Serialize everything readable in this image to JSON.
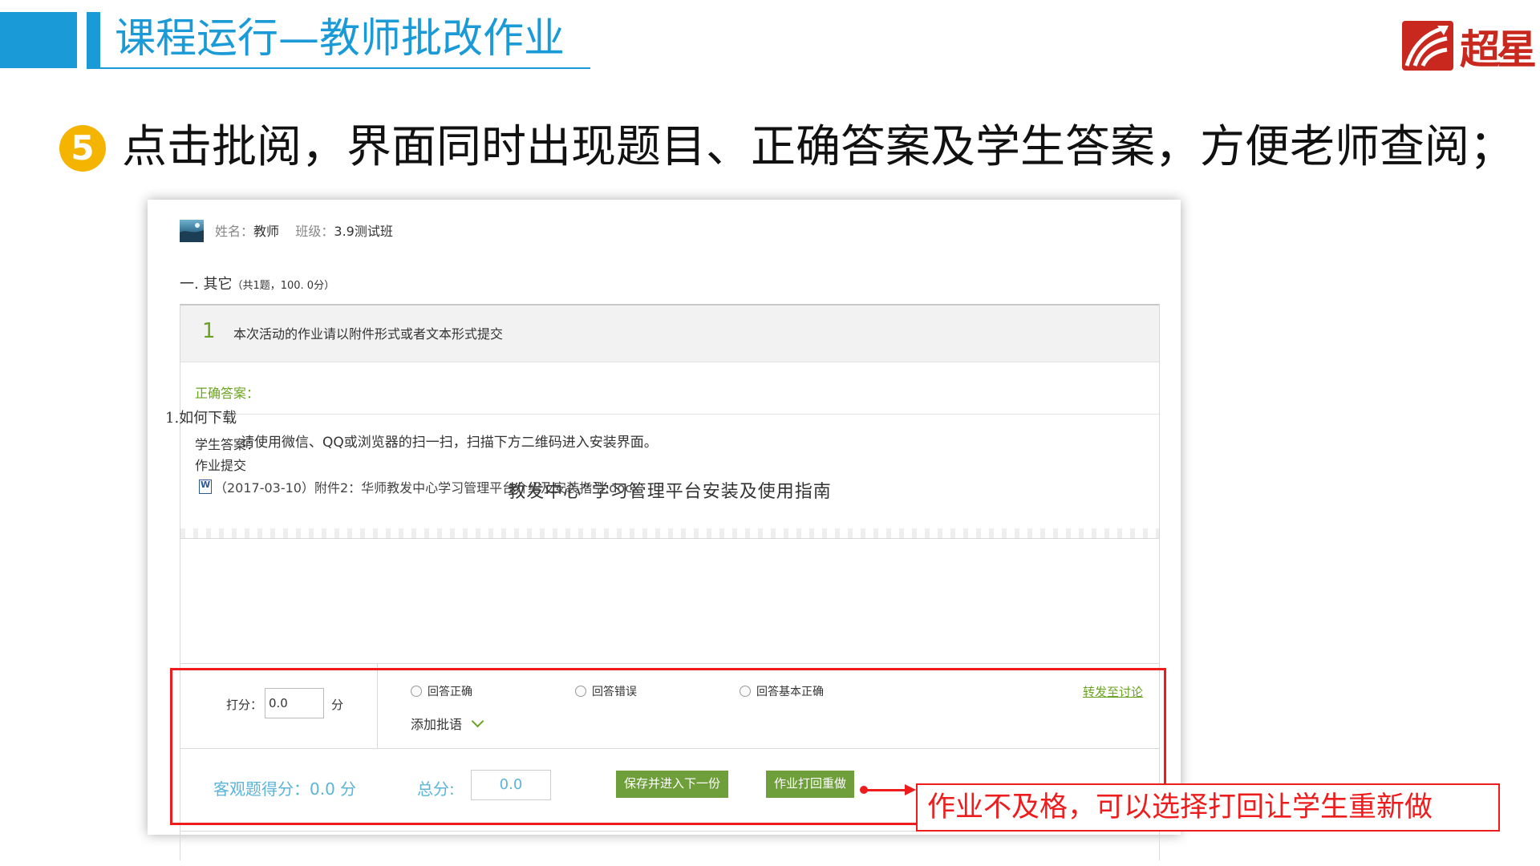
{
  "slide": {
    "title": "课程运行—教师批改作业",
    "logo_text": "超星",
    "bullet_number": "5",
    "bullet_text": "点击批阅，界面同时出现题目、正确答案及学生答案，方便老师查阅；",
    "callout_text": "作业不及格，可以选择打回让学生重新做"
  },
  "student": {
    "name_label": "姓名：",
    "name": "教师",
    "class_label": "班级：",
    "class": "3.9测试班"
  },
  "section": {
    "title": "一. 其它",
    "meta": "（共1题，100. 0分）"
  },
  "question": {
    "number": "1",
    "text": "本次活动的作业请以附件形式或者文本形式提交",
    "correct_answer_label": "正确答案：",
    "student_answer_label": "学生答案：",
    "student_answer_sub": "作业提交",
    "doc_title": "教发中心”学习管理平台安装及使用指南",
    "howto_title": "1.如何下载",
    "howto_body": "请使用微信、QQ或浏览器的扫一扫，扫描下方二维码进入安装界面。",
    "attachment": "（2017-03-10）附件2：华师教发中心学习管理平台介绍及安装指引.docx"
  },
  "grading": {
    "score_label": "打分：",
    "score_value": "0.0",
    "score_unit": "分",
    "radio_correct": "回答正确",
    "radio_wrong": "回答错误",
    "radio_partial": "回答基本正确",
    "forward_link": "转发至讨论",
    "add_comment": "添加批语",
    "objective_score": "客观题得分：0.0 分",
    "total_label": "总分:",
    "total_value": "0.0",
    "save_next_button": "保存并进入下一份",
    "return_redo_button": "作业打回重做"
  },
  "colors": {
    "accent_blue": "#1a9bd7",
    "green": "#6aa320",
    "red": "#ee1c1c"
  }
}
